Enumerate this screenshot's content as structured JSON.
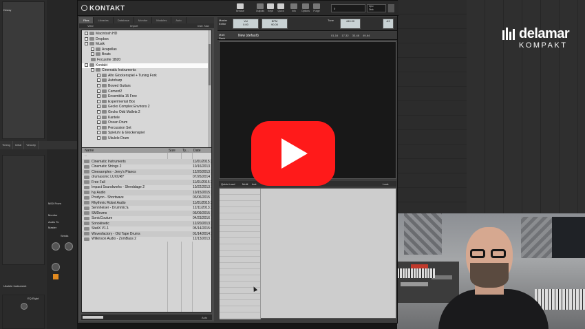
{
  "kontakt": {
    "app_name": "KONTAKT",
    "toolbar": [
      {
        "label": "Browse",
        "icon": "browse-icon"
      },
      {
        "label": "Outputs",
        "icon": "outputs-icon"
      },
      {
        "label": "Keyb",
        "icon": "keyboard-icon"
      },
      {
        "label": "Quick",
        "icon": "quick-icon"
      },
      {
        "label": "Info",
        "icon": "info-icon"
      },
      {
        "label": "Options",
        "icon": "options-icon"
      },
      {
        "label": "Purge",
        "icon": "purge-icon"
      }
    ],
    "cpu_label": "Cpu",
    "disk_label": "Disk",
    "memory_value": "0"
  },
  "browser": {
    "tabs": [
      "Files",
      "Libraries",
      "Database",
      "Monitor",
      "Modules",
      "Auto"
    ],
    "bar_left": "View",
    "bar_mid": "Import",
    "bar_right": "Instr. Nav",
    "tree": [
      {
        "label": "Macintosh HD",
        "indent": 0,
        "expander": true
      },
      {
        "label": "Dropbox",
        "indent": 0,
        "expander": true
      },
      {
        "label": "Musik",
        "indent": 0,
        "expander": true
      },
      {
        "label": "Acapellas",
        "indent": 1,
        "expander": true
      },
      {
        "label": "Beats",
        "indent": 1,
        "expander": true
      },
      {
        "label": "Focusrite 18i20",
        "indent": 1,
        "expander": false
      },
      {
        "label": "Kontakt",
        "indent": 0,
        "expander": true,
        "selected": true
      },
      {
        "label": "Cinematic Instruments",
        "indent": 1,
        "expander": true
      },
      {
        "label": "Alto Glockenspiel + Tuning Fork",
        "indent": 2,
        "expander": true
      },
      {
        "label": "Autoharp",
        "indent": 2,
        "expander": true
      },
      {
        "label": "Bowed Guitars",
        "indent": 2,
        "expander": true
      },
      {
        "label": "Cement2",
        "indent": 2,
        "expander": true
      },
      {
        "label": "Ensemblia 15 Free",
        "indent": 2,
        "expander": true
      },
      {
        "label": "Experimental Box",
        "indent": 2,
        "expander": true
      },
      {
        "label": "Gecko Complex Environs 2",
        "indent": 2,
        "expander": true
      },
      {
        "label": "Gecko Odd Mallets 2",
        "indent": 2,
        "expander": true
      },
      {
        "label": "Kantele",
        "indent": 2,
        "expander": true
      },
      {
        "label": "Ocean Drum",
        "indent": 2,
        "expander": true
      },
      {
        "label": "Percussion Set",
        "indent": 2,
        "expander": true
      },
      {
        "label": "Spieluhr & Glockenspiel",
        "indent": 2,
        "expander": true
      },
      {
        "label": "Ukulele Drum",
        "indent": 2,
        "expander": true
      }
    ],
    "columns": [
      "Name",
      "Size",
      "Ty...",
      "Date"
    ],
    "up_label": "..",
    "files": [
      {
        "name": "Cinematic Instruments",
        "date": "11/01/2015 2"
      },
      {
        "name": "Cinematic Strings 2",
        "date": "10/16/2013 1"
      },
      {
        "name": "Cinesamples - Jerry's Pianos",
        "date": "12/20/2013 1"
      },
      {
        "name": "drumasonic LUXURY",
        "date": "07/26/2014 1"
      },
      {
        "name": "Free Fall",
        "date": "11/01/2015 2"
      },
      {
        "name": "Impact Soundworks - Shreddage 2",
        "date": "10/22/2013 2"
      },
      {
        "name": "Ivy Audio",
        "date": "10/15/2015 2"
      },
      {
        "name": "Prodyon - Shortwave",
        "date": "03/06/2015 1"
      },
      {
        "name": "Rhythmic Robot Audio",
        "date": "11/01/2015 2"
      },
      {
        "name": "Sennheiser - Drummic'a",
        "date": "12/11/2013 2"
      },
      {
        "name": "SMDrums",
        "date": "03/09/2015 1"
      },
      {
        "name": "SonicCouture",
        "date": "04/23/2016 1"
      },
      {
        "name": "Sonokinetic",
        "date": "12/20/2013 2"
      },
      {
        "name": "StatiX V1.1",
        "date": "05/14/2015 0"
      },
      {
        "name": "Wavesfactory - Old Tape Drums",
        "date": "01/14/2014 2"
      },
      {
        "name": "Wilkinson Audio - ZomBass 2",
        "date": "12/13/2013 2"
      }
    ],
    "bottom_label": "Auto"
  },
  "rack": {
    "master_editor": "Master Editor",
    "vol_label": "Vol",
    "vol_value": "0.00",
    "bpm_label": "BPM",
    "bpm_value": "90.00",
    "tune_label": "Tune",
    "tune_value": "440.00",
    "key_value": "A3",
    "multi_rack": "Multi Rack",
    "multi_name": "New (default)",
    "pages": [
      "01-16",
      "17-32",
      "33-48",
      "49-64"
    ],
    "quick_load": "Quick-Load",
    "multi_tab": "Multi",
    "instr_tab": "Inst",
    "lock": "Lock"
  },
  "daw": {
    "left_tabs": [
      "Timing",
      "Initial",
      "Velocity"
    ],
    "name_text": "Deasy",
    "midi_from": "MIDI From",
    "monitor": "Monitor",
    "audio_to": "Audio To",
    "master": "Master",
    "sends": "Sends",
    "track_name": "Ukulele Instrument",
    "eq": "EQ Eight"
  },
  "logo": {
    "name": "delamar",
    "sub": "KOMPAKT"
  },
  "colors": {
    "play_red": "#ff1a1a",
    "accent_orange": "#e28a1f"
  }
}
